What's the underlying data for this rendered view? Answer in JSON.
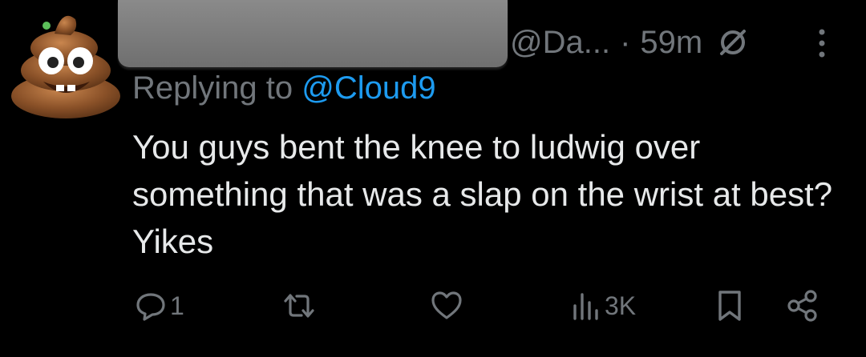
{
  "tweet": {
    "handle": "@Da...",
    "separator": "·",
    "time": "59m",
    "reply_prefix": "Replying to",
    "reply_mention": "@Cloud9",
    "text": "You guys bent the knee to ludwig over something that was a slap on the wrist at best? Yikes"
  },
  "icons": {
    "avatar": "poop-emoji-avatar",
    "limited": "limited-visibility-icon",
    "more": "more-options-icon",
    "reply": "reply-icon",
    "retweet": "retweet-icon",
    "like": "like-heart-icon",
    "views": "views-icon",
    "bookmark": "bookmark-icon",
    "share": "share-icon"
  },
  "actions": {
    "reply_count": "1",
    "views_count": "3K"
  },
  "colors": {
    "background": "#000000",
    "text": "#e7e9ea",
    "muted": "#71767b",
    "link": "#1d9bf0"
  }
}
